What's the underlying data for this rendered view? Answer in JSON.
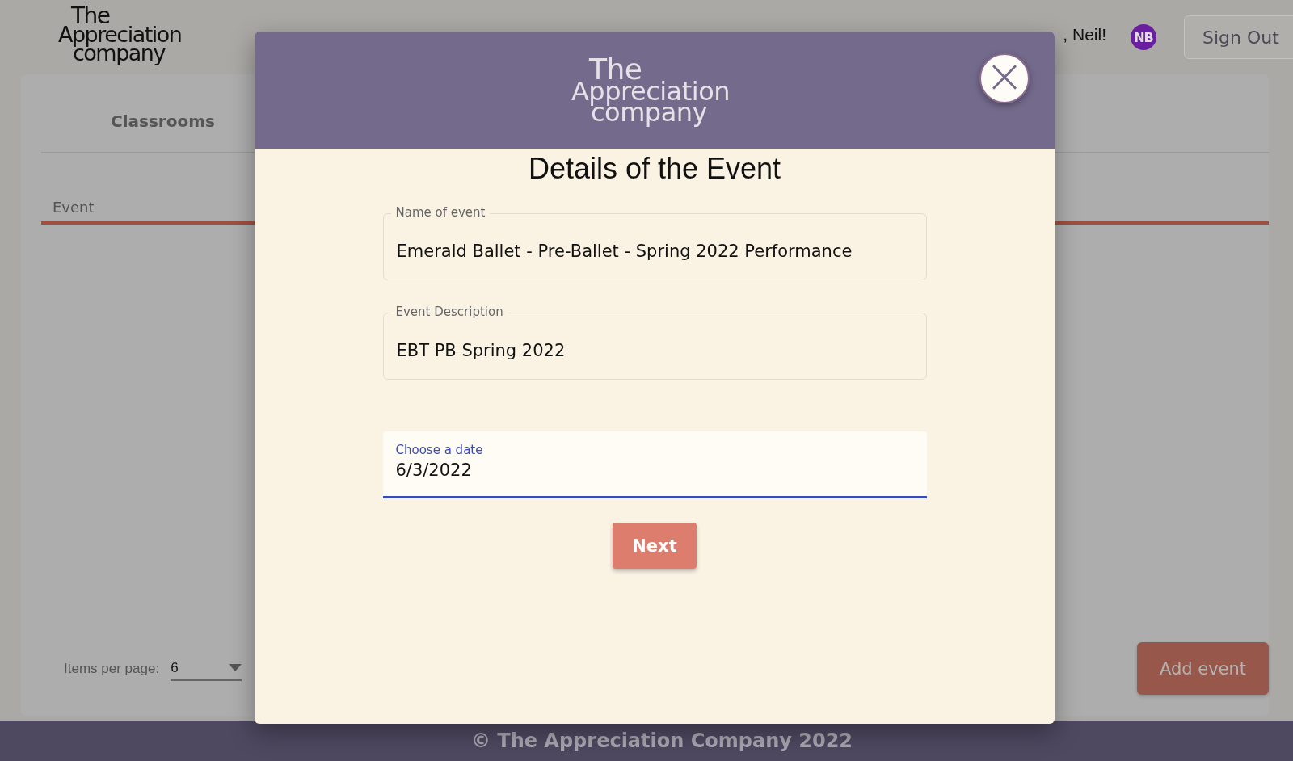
{
  "header": {
    "logo": [
      "The",
      "Appreciation",
      "company"
    ],
    "greeting": ", Neil!",
    "avatar": "NB",
    "sign_out": "Sign Out"
  },
  "section_title": "Classrooms",
  "table": {
    "columns": [
      "Event"
    ]
  },
  "paginator": {
    "label": "Items per page:",
    "value": "6"
  },
  "add_button": "Add event",
  "footer": "© The Appreciation Company 2022",
  "modal": {
    "logo": [
      "The",
      "Appreciation",
      "company"
    ],
    "close": "×",
    "title": "Details of the Event",
    "fields": [
      {
        "kind": "outlined",
        "label": "Name of event",
        "value": "Emerald Ballet - Pre-Ballet - Spring 2022 Performance"
      },
      {
        "kind": "outlined",
        "label": "Event Description",
        "value": "EBT PB Spring 2022"
      },
      {
        "kind": "filled",
        "label": "Choose a date",
        "value": "6/3/2022"
      }
    ],
    "button": "Next"
  }
}
